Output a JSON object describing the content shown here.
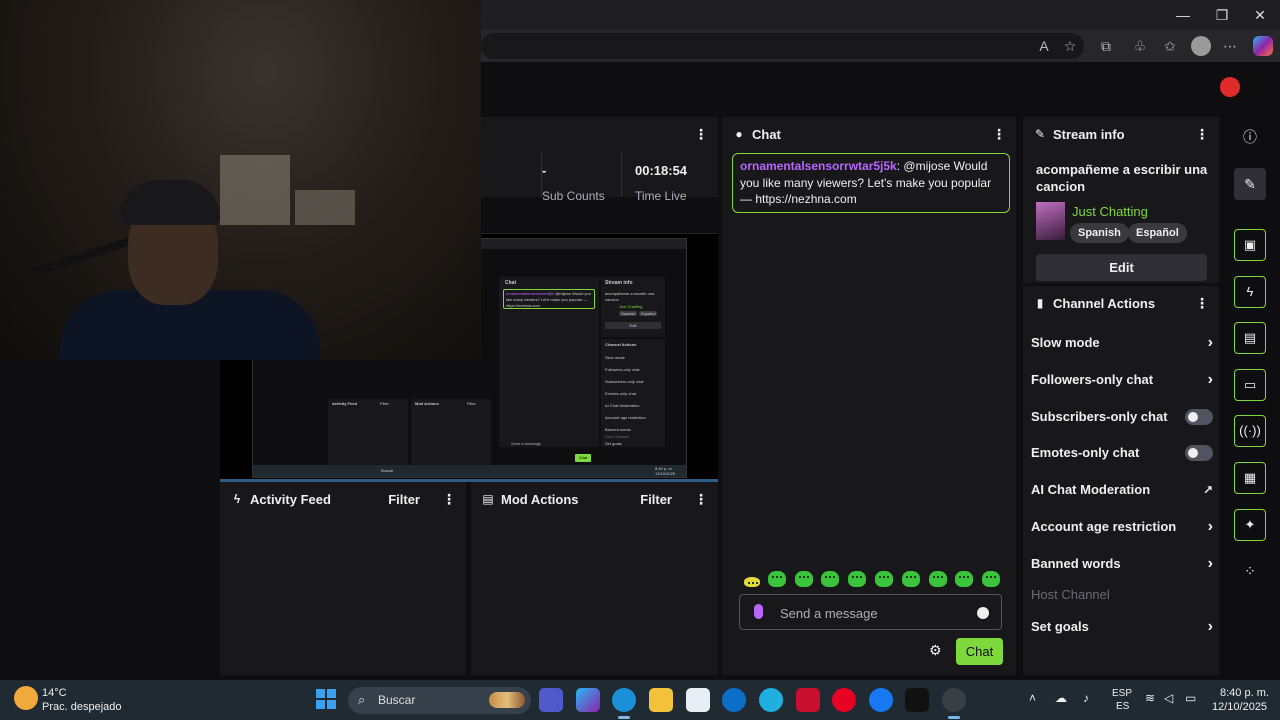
{
  "browser": {
    "minimize": "—",
    "maximize": "❐",
    "close": "✕",
    "toolbar_icons": [
      "read-aloud-icon",
      "favorite-star-icon",
      "extensions-icon",
      "app-icon",
      "favorites-icon",
      "profile-icon",
      "more-icon",
      "copilot-icon"
    ]
  },
  "stats": {
    "sub_count_value": "-",
    "sub_count_label": "Sub Counts",
    "time_live_value": "00:18:54",
    "time_live_label": "Time Live"
  },
  "chat": {
    "title": "Chat",
    "message_user": "ornamentalsensorrwtar5j5k",
    "message_text": ": @mijose Would you like many viewers? Let's make you popular — https://nezhna.com",
    "input_placeholder": "Send a message",
    "send_label": "Chat"
  },
  "stream_info": {
    "title": "Stream info",
    "stream_title": "acompañeme a escribir una cancion",
    "category": "Just Chatting",
    "tags": [
      "Spanish",
      "Español"
    ],
    "edit_label": "Edit"
  },
  "channel_actions": {
    "title": "Channel Actions",
    "items": [
      {
        "label": "Slow mode",
        "control": "arrow"
      },
      {
        "label": "Followers-only chat",
        "control": "arrow"
      },
      {
        "label": "Subscribers-only chat",
        "control": "toggle"
      },
      {
        "label": "Emotes-only chat",
        "control": "toggle"
      },
      {
        "label": "AI Chat Moderation",
        "control": "external"
      },
      {
        "label": "Account age restriction",
        "control": "arrow"
      },
      {
        "label": "Banned words",
        "control": "arrow"
      },
      {
        "label": "Host Channel",
        "control": "disabled"
      },
      {
        "label": "Set goals",
        "control": "arrow"
      }
    ]
  },
  "activity_feed": {
    "title": "Activity Feed",
    "filter": "Filter"
  },
  "mod_actions": {
    "title": "Mod Actions",
    "filter": "Filter"
  },
  "preview": {
    "chat_label": "Chat",
    "stream_info_label": "Stream info",
    "stream_title": "acompañeme a escribir una cancion",
    "category": "Just Chatting",
    "tags": [
      "Spanish",
      "Español"
    ],
    "edit_label": "Edit",
    "channel_actions_label": "Channel Actions",
    "actions": [
      "Slow mode",
      "Followers-only chat",
      "Subscribers-only chat",
      "Emotes-only chat",
      "AI Chat Moderation",
      "Account age restriction",
      "Banned words",
      "Host Channel",
      "Set goals"
    ],
    "message_user": "ornamentalsensorrwtar5j5k",
    "message_text": "@mijose Would you like many viewers? Let's make you popular — https://nezhna.com",
    "input_placeholder": "Send a message",
    "send_label": "Chat",
    "activity_label": "Activity Feed",
    "mod_label": "Mod Actions",
    "filter": "Filter",
    "taskbar_search": "Buscar",
    "taskbar_time": "8:40 p. m.",
    "taskbar_date": "12/10/2025"
  },
  "taskbar": {
    "temperature": "14°C",
    "weather": "Prac. despejado",
    "search": "Buscar",
    "language_top": "ESP",
    "language_bottom": "ES",
    "time": "8:40 p. m.",
    "date": "12/10/2025"
  },
  "colors": {
    "accent": "#7fd93c",
    "username": "#b965ff",
    "panel": "#18181b",
    "background": "#0e0e10"
  }
}
